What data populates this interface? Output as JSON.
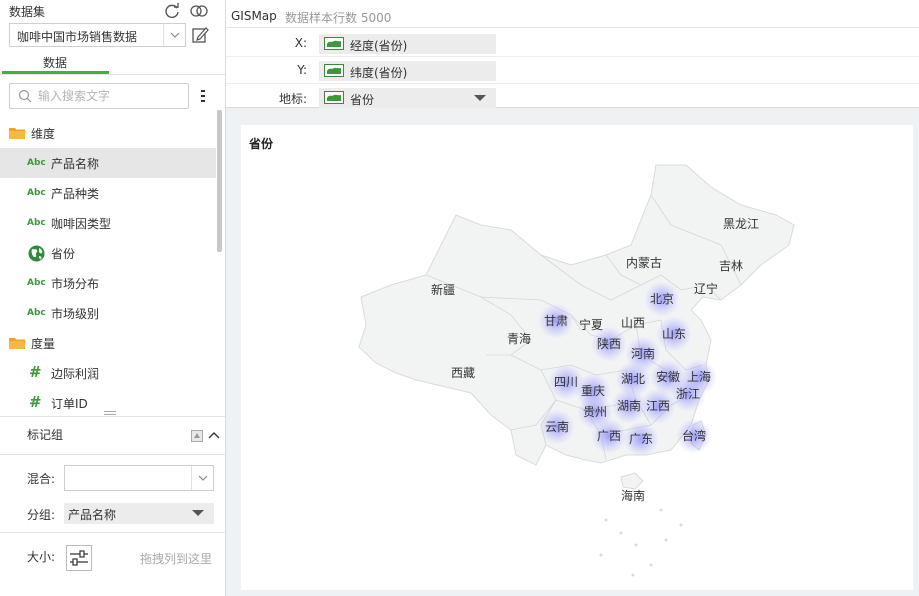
{
  "left_panel": {
    "dataset_title": "数据集",
    "dataset_value": "咖啡中国市场销售数据",
    "tab_label": "数据",
    "search_placeholder": "输入搜索文字",
    "dimension_group": "维度",
    "measure_group": "度量",
    "dimensions": [
      {
        "type": "Abc",
        "label": "产品名称",
        "selected": true
      },
      {
        "type": "Abc",
        "label": "产品种类",
        "selected": false
      },
      {
        "type": "Abc",
        "label": "咖啡因类型",
        "selected": false
      },
      {
        "type": "geo",
        "label": "省份",
        "selected": false
      },
      {
        "type": "Abc",
        "label": "市场分布",
        "selected": false
      },
      {
        "type": "Abc",
        "label": "市场级别",
        "selected": false
      }
    ],
    "measures": [
      {
        "type": "#",
        "label": "边际利润"
      },
      {
        "type": "#",
        "label": "订单ID"
      }
    ],
    "marks": {
      "title": "标记组",
      "mix_label": "混合:",
      "mix_value": "",
      "group_label": "分组:",
      "group_value": "产品名称",
      "size_label": "大小:",
      "drop_hint": "拖拽列到这里"
    }
  },
  "right_panel": {
    "chart_type": "GISMap",
    "sample_info": "数据样本行数 5000",
    "x_label": "X:",
    "x_value": "经度(省份)",
    "y_label": "Y:",
    "y_value": "纬度(省份)",
    "geo_label": "地标:",
    "geo_value": "省份",
    "map_title": "省份"
  },
  "colors": {
    "accent": "#3cb34a",
    "heat": "#8c8cff"
  },
  "chart_data": {
    "type": "heatmap",
    "title": "省份",
    "provinces": [
      {
        "name": "黑龙江",
        "heat": false
      },
      {
        "name": "吉林",
        "heat": false
      },
      {
        "name": "内蒙古",
        "heat": false
      },
      {
        "name": "辽宁",
        "heat": false
      },
      {
        "name": "新疆",
        "heat": false
      },
      {
        "name": "北京",
        "heat": true
      },
      {
        "name": "甘肃",
        "heat": true
      },
      {
        "name": "宁夏",
        "heat": false
      },
      {
        "name": "山西",
        "heat": false
      },
      {
        "name": "山东",
        "heat": true
      },
      {
        "name": "青海",
        "heat": false
      },
      {
        "name": "陕西",
        "heat": true
      },
      {
        "name": "河南",
        "heat": true
      },
      {
        "name": "西藏",
        "heat": false
      },
      {
        "name": "四川",
        "heat": true
      },
      {
        "name": "湖北",
        "heat": true
      },
      {
        "name": "安徽",
        "heat": true
      },
      {
        "name": "上海",
        "heat": true
      },
      {
        "name": "重庆",
        "heat": true
      },
      {
        "name": "浙江",
        "heat": true
      },
      {
        "name": "贵州",
        "heat": true
      },
      {
        "name": "湖南",
        "heat": true
      },
      {
        "name": "江西",
        "heat": true
      },
      {
        "name": "云南",
        "heat": true
      },
      {
        "name": "广西",
        "heat": true
      },
      {
        "name": "广东",
        "heat": true
      },
      {
        "name": "台湾",
        "heat": true
      },
      {
        "name": "海南",
        "heat": false
      }
    ]
  }
}
